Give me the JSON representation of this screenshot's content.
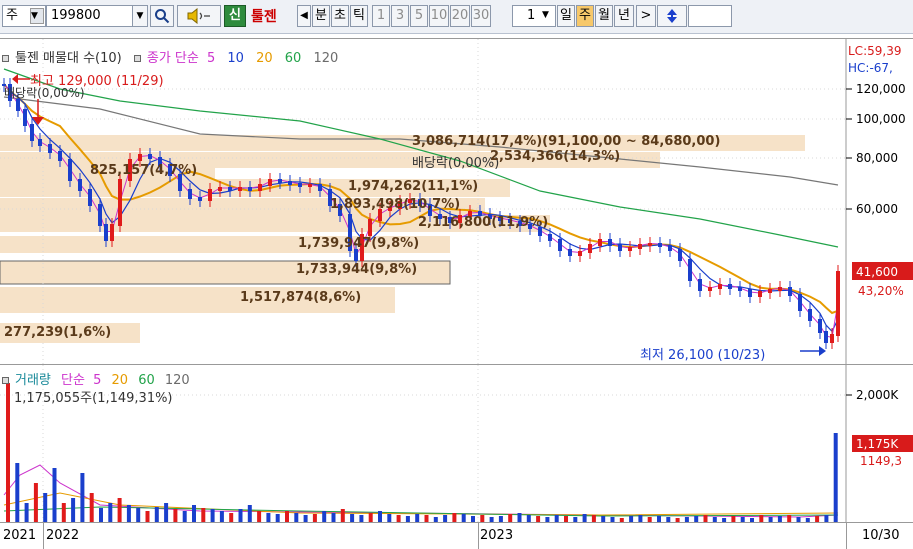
{
  "toolbar": {
    "market_select": "주",
    "code": "199800",
    "search_icon": "search-icon",
    "speaker_icon": "speaker-icon",
    "credit_badge": "신",
    "stock_name": "툴젠",
    "nav_prev": "◀",
    "periods": [
      "분",
      "초",
      "틱",
      "1",
      "3",
      "5",
      "10",
      "20",
      "30"
    ],
    "period_value": "1",
    "ranges": [
      "일",
      "주",
      "월",
      "년"
    ],
    "range_active": "주",
    "nav_next": ">",
    "updown_icon": "updown-icon",
    "colors": {
      "active_range": "#f7c86a",
      "credit": "#2e8b3d",
      "stock_name": "#cc0000"
    }
  },
  "main_legend": {
    "title": "툴젠 매물대 수(10)",
    "close_label": "종가 단순",
    "ma": [
      {
        "label": "5",
        "color": "#cc33cc"
      },
      {
        "label": "10",
        "color": "#1a3fcc"
      },
      {
        "label": "20",
        "color": "#e69b00"
      },
      {
        "label": "60",
        "color": "#22a34a"
      },
      {
        "label": "120",
        "color": "#6b6b6b"
      }
    ],
    "lc": "LC:59,39",
    "hc": "HC:-67,"
  },
  "annotations": {
    "high": "최고 129,000 (11/29)",
    "dividend_top": "배당락(0,00%)",
    "dividend_mid": "배당락(0,00%)",
    "low": "최저 26,100 (10/23)",
    "current_price": "41,600",
    "current_pct": "43,20%"
  },
  "volume_profile": [
    {
      "label": "3,086,714(17,4%)(91,100,00 ~ 84,680,00)"
    },
    {
      "label": "2,534,366(14,3%)"
    },
    {
      "label": "825,157(4,7%)"
    },
    {
      "label": "1,974,262(11,1%)"
    },
    {
      "label": "1,893,498(10,7%)"
    },
    {
      "label": "2,116,800(11,9%)"
    },
    {
      "label": "1,739,947(9,8%)"
    },
    {
      "label": "1,733,944(9,8%)"
    },
    {
      "label": "1,517,874(8,6%)"
    },
    {
      "label": "277,239(1,6%)"
    }
  ],
  "price_axis": [
    "120,000",
    "100,000",
    "80,000",
    "60,000"
  ],
  "vol_legend": {
    "title": "거래량",
    "label": "단순",
    "ma": [
      {
        "label": "5",
        "color": "#cc33cc"
      },
      {
        "label": "20",
        "color": "#e69b00"
      },
      {
        "label": "60",
        "color": "#22a34a"
      },
      {
        "label": "120",
        "color": "#6b6b6b"
      }
    ],
    "current": "1,175,055주(1,149,31%)"
  },
  "vol_axis": [
    "2,000K"
  ],
  "vol_current": "1,175K",
  "vol_pct": "1149,3",
  "x_axis": [
    "2021",
    "2022",
    "2023",
    "10/30"
  ]
}
